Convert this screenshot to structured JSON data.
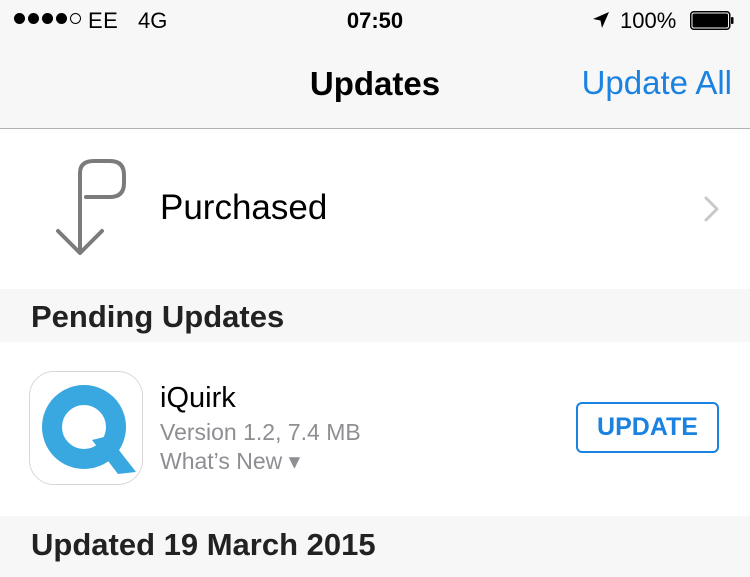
{
  "status_bar": {
    "signal_bars_filled": 4,
    "signal_bars_total": 5,
    "carrier": "EE",
    "network": "4G",
    "time": "07:50",
    "location_icon": "location-arrow-icon",
    "battery_percent": "100%",
    "battery_level": 1.0
  },
  "nav": {
    "title": "Updates",
    "update_all_label": "Update All"
  },
  "purchased": {
    "icon": "purchased-arrow-icon",
    "label": "Purchased",
    "chevron": "chevron-right-icon"
  },
  "sections": {
    "pending": "Pending Updates",
    "updated": "Updated 19 March 2015"
  },
  "apps": [
    {
      "icon": "iquirk-app-icon",
      "name": "iQuirk",
      "version": "Version 1.2, 7.4 MB",
      "whats_new": "What’s New ▾",
      "button_label": "UPDATE"
    }
  ],
  "colors": {
    "accent": "#1a82e0",
    "bar_background": "#f7f7f7",
    "secondary_text": "#8e8e93",
    "iquirk_icon": "#3aa8e0"
  }
}
